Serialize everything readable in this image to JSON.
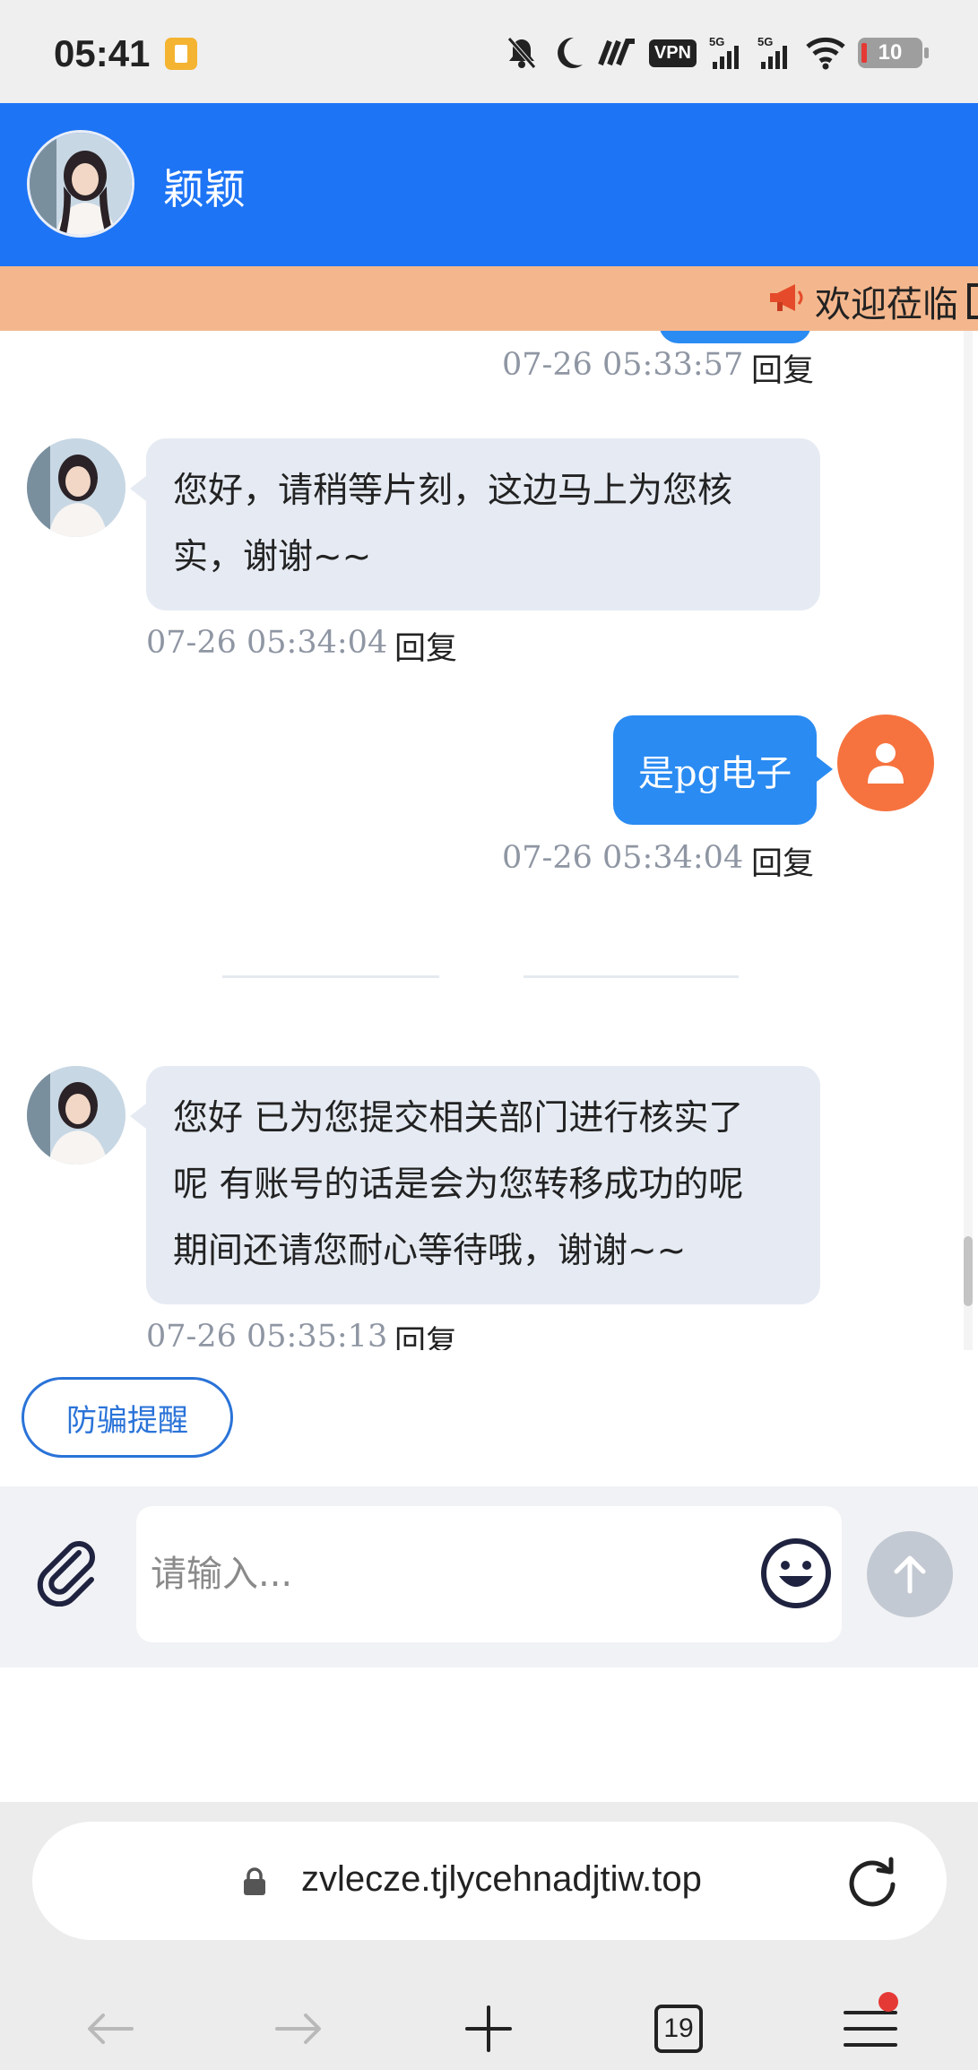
{
  "status_bar": {
    "time": "05:41",
    "vpn": "VPN",
    "signal_1": "5G",
    "signal_2": "5G",
    "battery": "10"
  },
  "header": {
    "contact_name": "颖颖"
  },
  "marquee": {
    "text": "欢迎莅临"
  },
  "messages": [
    {
      "sender": "user",
      "text": "",
      "time": "07-26 05:33:57",
      "reply_label": "回复"
    },
    {
      "sender": "agent",
      "lines": [
        "您好，请稍等片刻，这边马上为您核",
        "实，谢谢~~"
      ],
      "time": "07-26 05:34:04",
      "reply_label": "回复"
    },
    {
      "sender": "user",
      "text": "是pg电子",
      "time": "07-26 05:34:04",
      "reply_label": "回复"
    },
    {
      "sender": "agent",
      "lines": [
        "您好 已为您提交相关部门进行核实了",
        "呢 有账号的话是会为您转移成功的呢",
        "期间还请您耐心等待哦，谢谢~~"
      ],
      "time": "07-26 05:35:13",
      "reply_label": "回复"
    }
  ],
  "anti_fraud_label": "防骗提醒",
  "composer": {
    "placeholder": "请输入..."
  },
  "browser": {
    "url": "zvlecze.tjlycehnadjtiw.top",
    "tab_count": "19"
  },
  "colors": {
    "header_blue": "#1d74f5",
    "user_bubble": "#2a8bf2",
    "agent_bubble": "#e6ebf3",
    "marquee_bg": "#f4b78d",
    "user_avatar": "#f6733f"
  }
}
